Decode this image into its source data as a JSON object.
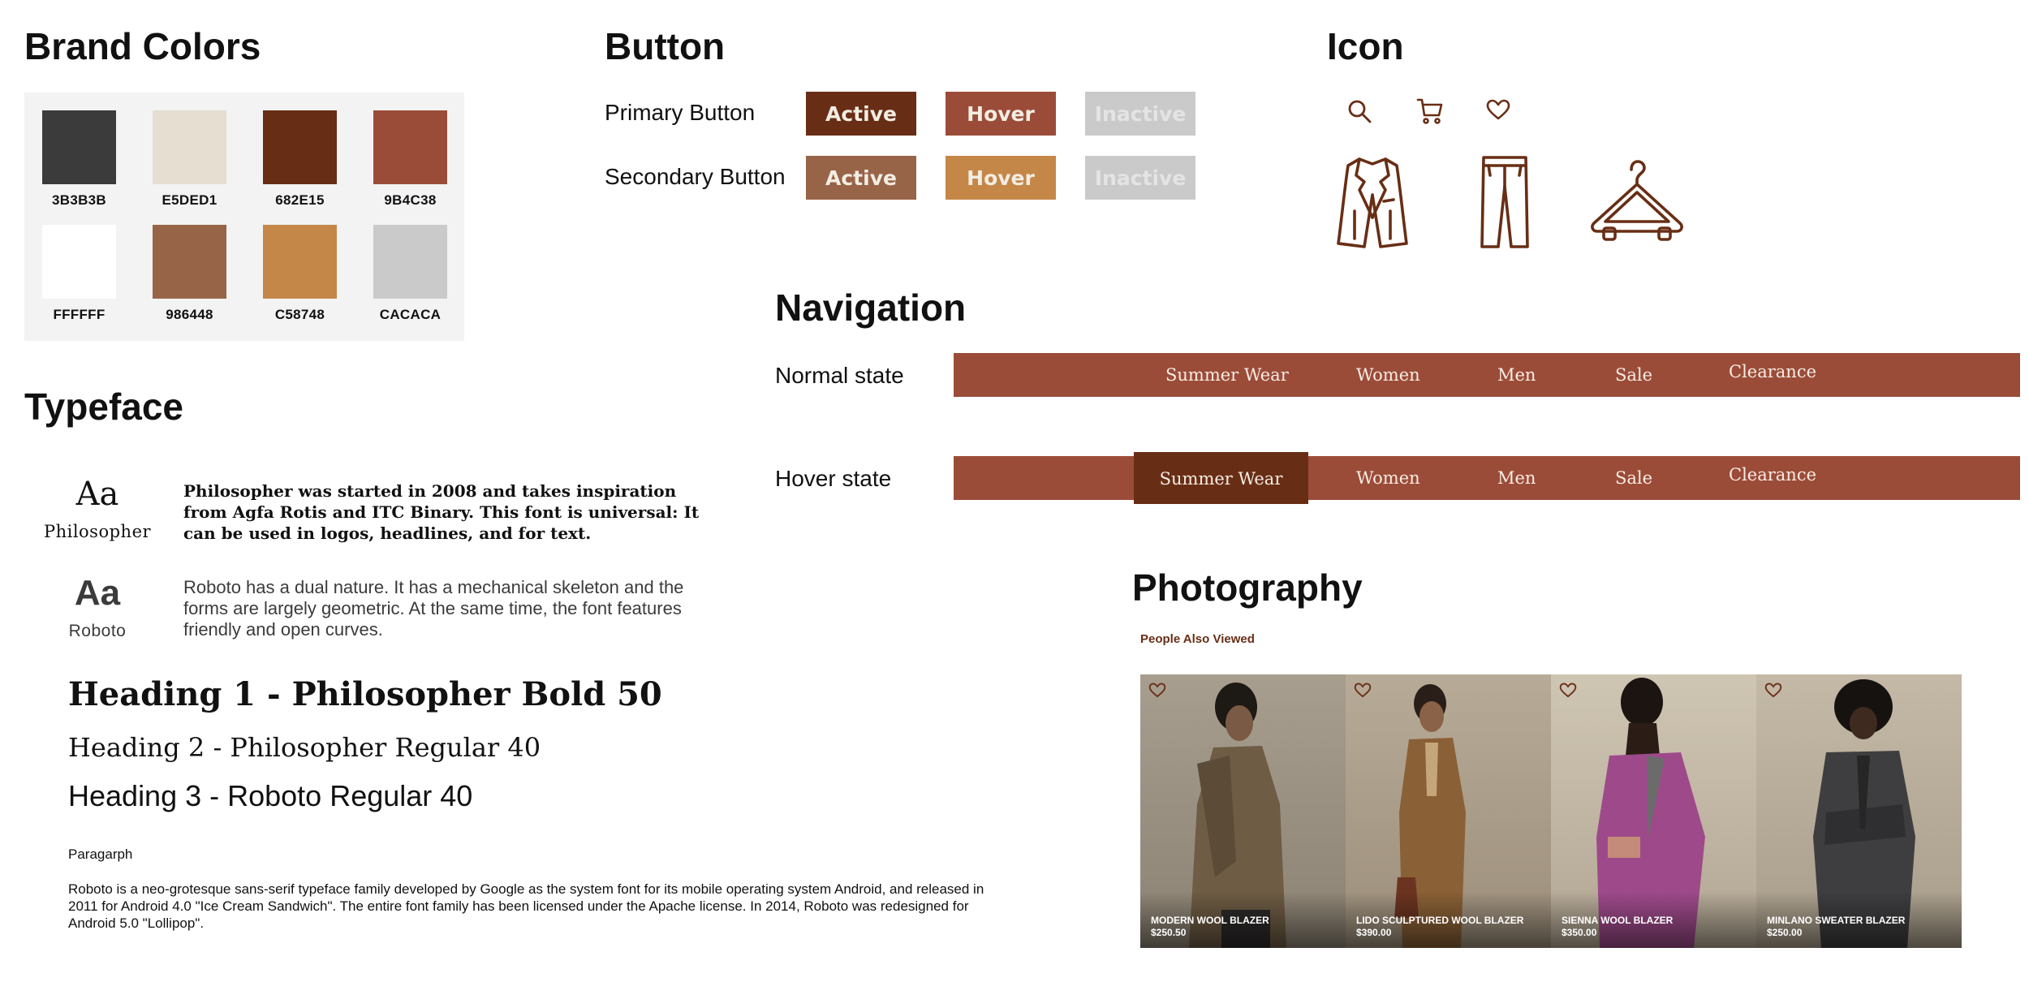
{
  "brand": {
    "title": "Brand Colors",
    "swatches": [
      {
        "hex": "#3B3B3B",
        "label": "3B3B3B"
      },
      {
        "hex": "#E5DED1",
        "label": "E5DED1"
      },
      {
        "hex": "#682E15",
        "label": "682E15"
      },
      {
        "hex": "#9B4C38",
        "label": "9B4C38"
      },
      {
        "hex": "#FFFFFF",
        "label": "FFFFFF"
      },
      {
        "hex": "#986448",
        "label": "986448"
      },
      {
        "hex": "#C58748",
        "label": "C58748"
      },
      {
        "hex": "#CACACA",
        "label": "CACACA"
      }
    ]
  },
  "buttons": {
    "title": "Button",
    "primary_label": "Primary Button",
    "secondary_label": "Secondary Button",
    "primary": {
      "active": {
        "label": "Active",
        "color": "#682E15"
      },
      "hover": {
        "label": "Hover",
        "color": "#9B4C38"
      },
      "inactive": {
        "label": "Inactive",
        "color": "#CACACA"
      }
    },
    "secondary": {
      "active": {
        "label": "Active",
        "color": "#986448"
      },
      "hover": {
        "label": "Hover",
        "color": "#C58748"
      },
      "inactive": {
        "label": "Inactive",
        "color": "#CACACA"
      }
    }
  },
  "icons": {
    "title": "Icon",
    "small": [
      "search-icon",
      "cart-icon",
      "heart-icon"
    ],
    "large": [
      "blazer-icon",
      "pants-icon",
      "hanger-icon"
    ],
    "color": "#682E15"
  },
  "navigation": {
    "title": "Navigation",
    "normal_label": "Normal state",
    "hover_label": "Hover state",
    "bar_color": "#9B4C38",
    "highlight_color": "#682E15",
    "items": [
      "Summer Wear",
      "Women",
      "Men",
      "Sale",
      "Clearance"
    ]
  },
  "typeface": {
    "title": "Typeface",
    "fonts": [
      {
        "sample": "Aa",
        "name": "Philosopher",
        "description": "Philosopher was started in 2008 and takes inspiration from Agfa Rotis and ITC Binary. This font is universal: It can be used in logos, headlines, and for text."
      },
      {
        "sample": "Aa",
        "name": "Roboto",
        "description": "Roboto has a dual nature. It has a mechanical skeleton and the forms are largely geometric. At the same time, the font features friendly and open curves."
      }
    ],
    "h1": "Heading 1 - Philosopher Bold 50",
    "h2": "Heading 2 - Philosopher Regular 40",
    "h3": "Heading 3 - Roboto Regular 40",
    "paragraph_label": "Paragarph",
    "paragraph": "Roboto is a neo-grotesque sans-serif typeface family developed by Google as the system font for its mobile operating system Android, and released in 2011 for Android 4.0 \"Ice Cream Sandwich\". The entire font family has been licensed under the Apache license. In 2014, Roboto was redesigned for Android 5.0 \"Lollipop\"."
  },
  "photography": {
    "title": "Photography",
    "subtitle": "People Also Viewed",
    "products": [
      {
        "name": "MODERN WOOL BLAZER",
        "price": "$250.50"
      },
      {
        "name": "LIDO SCULPTURED WOOL BLAZER",
        "price": "$390.00"
      },
      {
        "name": "SIENNA WOOL BLAZER",
        "price": "$350.00"
      },
      {
        "name": "MINLANO SWEATER BLAZER",
        "price": "$250.00"
      }
    ]
  }
}
